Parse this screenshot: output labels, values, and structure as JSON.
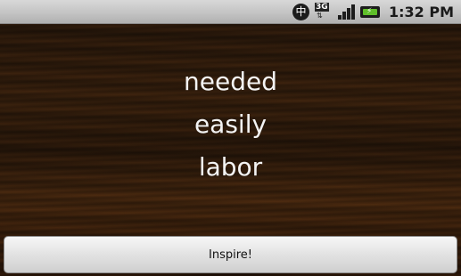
{
  "status_bar": {
    "notification_glyph": "中",
    "network_badge": "3G",
    "time": "1:32 PM"
  },
  "words": [
    "needed",
    "easily",
    "labor"
  ],
  "inspire_button": {
    "label": "Inspire!"
  }
}
